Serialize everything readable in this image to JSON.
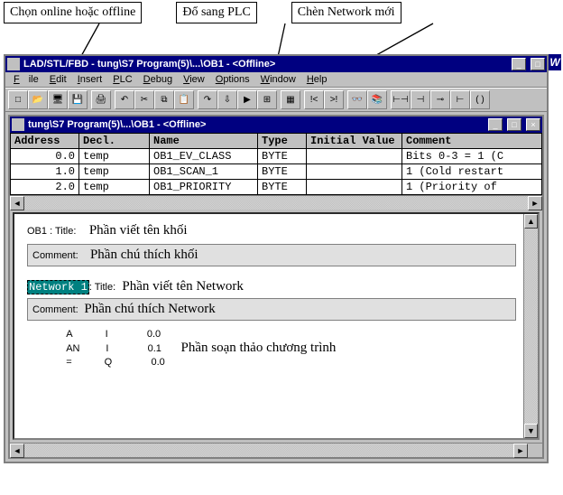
{
  "callouts": {
    "c1": "Chọn online hoặc offline",
    "c2": "Đổ sang PLC",
    "c3": "Chèn Network mới"
  },
  "app_title": "LAD/STL/FBD  - tung\\S7 Program(5)\\...\\OB1 - <Offline>",
  "side_letter": "W",
  "menu": {
    "file": "File",
    "edit": "Edit",
    "insert": "Insert",
    "plc": "PLC",
    "debug": "Debug",
    "view": "View",
    "options": "Options",
    "window": "Window",
    "help": "Help"
  },
  "child_title": "tung\\S7 Program(5)\\...\\OB1 - <Offline>",
  "table": {
    "headers": {
      "address": "Address",
      "decl": "Decl.",
      "name": "Name",
      "type": "Type",
      "init": "Initial Value",
      "comment": "Comment"
    },
    "rows": [
      {
        "address": "0.0",
        "decl": "temp",
        "name": "OB1_EV_CLASS",
        "type": "BYTE",
        "init": "",
        "comment": "Bits 0-3 = 1 (C"
      },
      {
        "address": "1.0",
        "decl": "temp",
        "name": "OB1_SCAN_1",
        "type": "BYTE",
        "init": "",
        "comment": "1 (Cold restart"
      },
      {
        "address": "2.0",
        "decl": "temp",
        "name": "OB1_PRIORITY",
        "type": "BYTE",
        "init": "",
        "comment": "1 (Priority of"
      }
    ]
  },
  "editor": {
    "ob_prefix": "OB1 : Title:",
    "ob_title": "Phần viết tên khối",
    "comment_label": "Comment:",
    "ob_comment": "Phần chú thích khối",
    "nw_label": "Network 1",
    "nw_title_prefix": ": Title:",
    "nw_title": "Phần viết tên Network",
    "nw_comment": "Phần chú thích Network",
    "stl_lines": [
      {
        "op": "A",
        "area": "I",
        "addr": "0.0"
      },
      {
        "op": "AN",
        "area": "I",
        "addr": "0.1"
      },
      {
        "op": "=",
        "area": "Q",
        "addr": "0.0"
      }
    ],
    "stl_note": "Phần soạn thảo chương trình"
  },
  "icons": {
    "new": "□",
    "open": "📂",
    "online": "🖥",
    "save": "💾",
    "print": "🖨",
    "cut": "✂",
    "copy": "⧉",
    "paste": "📋",
    "undo": "↶",
    "redo": "↷",
    "download": "⇩",
    "go": "▶",
    "block": "▦",
    "nw": "⊞",
    "prev": "!<",
    "next": ">!",
    "mon": "👓",
    "catalog": "📚",
    "and": "⊢⊣",
    "or": "( )",
    "coil": "⊸",
    "branch": "⊢",
    "con": "⊣"
  }
}
